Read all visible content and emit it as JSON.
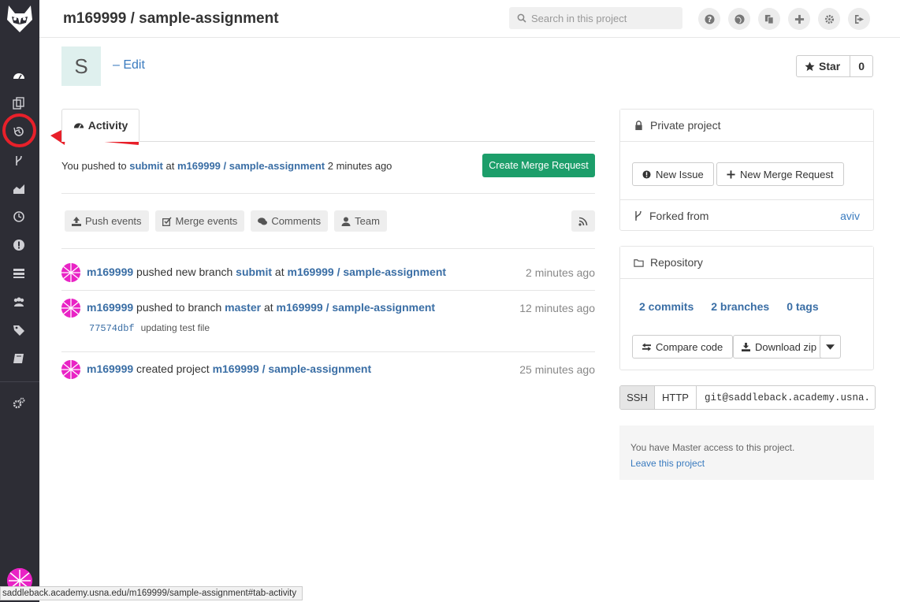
{
  "header": {
    "title": "m169999 / sample-assignment",
    "search_placeholder": "Search in this project"
  },
  "project": {
    "avatar_letter": "S",
    "edit_label": "– Edit",
    "star_label": "Star",
    "star_count": "0"
  },
  "tabs": {
    "activity_label": "Activity"
  },
  "push_notice": {
    "prefix": "You pushed to ",
    "branch": "submit",
    "mid": " at ",
    "project": "m169999 / sample-assignment",
    "time": " 2 minutes ago",
    "button": "Create Merge Request"
  },
  "filters": {
    "push": "Push events",
    "merge": "Merge events",
    "comments": "Comments",
    "team": "Team"
  },
  "events": [
    {
      "user": "m169999",
      "action": " pushed new branch ",
      "ref": "submit",
      "at": " at ",
      "project": "m169999 / sample-assignment",
      "time": "2 minutes ago"
    },
    {
      "user": "m169999",
      "action": " pushed to branch ",
      "ref": "master",
      "at": " at ",
      "project": "m169999 / sample-assignment",
      "time": "12 minutes ago",
      "commit_sha": "77574dbf",
      "commit_msg": "updating test file"
    },
    {
      "user": "m169999",
      "action": " created project ",
      "project": "m169999 / sample-assignment",
      "time": "25 minutes ago"
    }
  ],
  "private_panel": {
    "title": "Private project",
    "new_issue": "New Issue",
    "new_mr": "New Merge Request",
    "forked_label": "Forked from",
    "forked_from": "aviv"
  },
  "repo_panel": {
    "title": "Repository",
    "commits": "2 commits",
    "branches": "2 branches",
    "tags": "0 tags",
    "compare": "Compare code",
    "download": "Download zip"
  },
  "clone": {
    "ssh": "SSH",
    "http": "HTTP",
    "url": "git@saddleback.academy.usna."
  },
  "access": {
    "text": "You have Master access to this project.",
    "leave": "Leave this project"
  },
  "statusbar": {
    "url": "saddleback.academy.usna.edu/m169999/sample-assignment#tab-activity"
  },
  "colors": {
    "sidebar": "#2d2d35",
    "accent_green": "#1c9e6a",
    "link": "#3a6ea5",
    "annotation_red": "#e8202a"
  }
}
